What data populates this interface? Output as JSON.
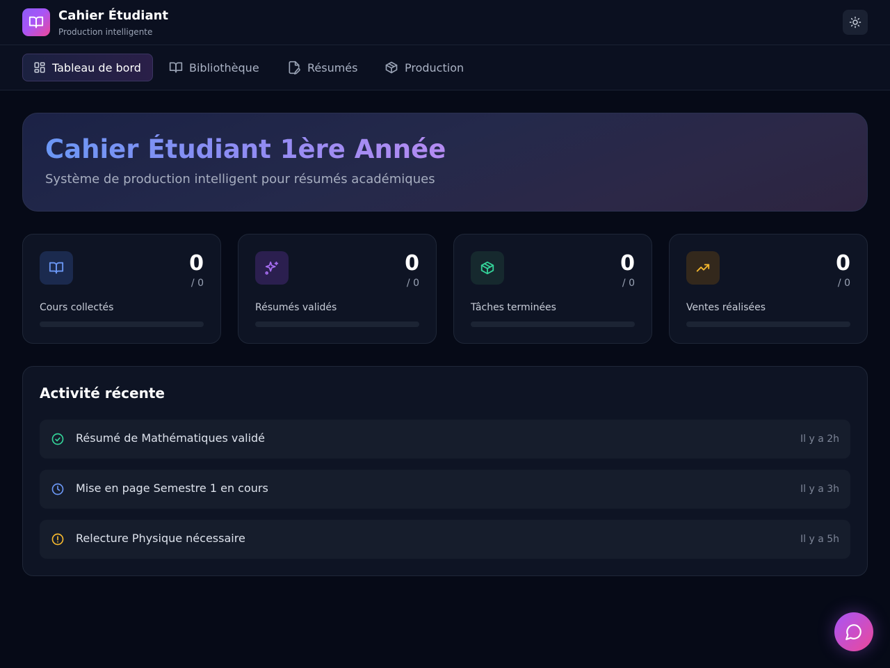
{
  "app": {
    "title": "Cahier Étudiant",
    "subtitle": "Production intelligente",
    "logo_icon": "book-open-icon",
    "theme_toggle_icon": "sun-icon"
  },
  "nav": {
    "tabs": [
      {
        "label": "Tableau de bord",
        "icon": "layout-dashboard-icon",
        "active": true
      },
      {
        "label": "Bibliothèque",
        "icon": "book-open-icon",
        "active": false
      },
      {
        "label": "Résumés",
        "icon": "file-pen-icon",
        "active": false
      },
      {
        "label": "Production",
        "icon": "package-icon",
        "active": false
      }
    ]
  },
  "hero": {
    "title": "Cahier Étudiant 1ère Année",
    "subtitle": "Système de production intelligent pour résumés académiques"
  },
  "stats": [
    {
      "value": "0",
      "total": "/ 0",
      "label": "Cours collectés",
      "progress": 0,
      "icon": "book-open-icon",
      "color": "#5b8def"
    },
    {
      "value": "0",
      "total": "/ 0",
      "label": "Résumés validés",
      "progress": 0,
      "icon": "sparkles-icon",
      "color": "#a56cf0"
    },
    {
      "value": "0",
      "total": "/ 0",
      "label": "Tâches terminées",
      "progress": 0,
      "icon": "package-icon",
      "color": "#34d399"
    },
    {
      "value": "0",
      "total": "/ 0",
      "label": "Ventes réalisées",
      "progress": 0,
      "icon": "trending-up-icon",
      "color": "#f5b82e"
    }
  ],
  "activity": {
    "title": "Activité récente",
    "items": [
      {
        "text": "Résumé de Mathématiques validé",
        "time": "Il y a 2h",
        "icon": "check-circle-icon",
        "color": "#34d399"
      },
      {
        "text": "Mise en page Semestre 1 en cours",
        "time": "Il y a 3h",
        "icon": "clock-icon",
        "color": "#6b97f5"
      },
      {
        "text": "Relecture Physique nécessaire",
        "time": "Il y a 5h",
        "icon": "alert-circle-icon",
        "color": "#f5b82e"
      }
    ]
  },
  "chat": {
    "icon": "message-circle-icon"
  }
}
